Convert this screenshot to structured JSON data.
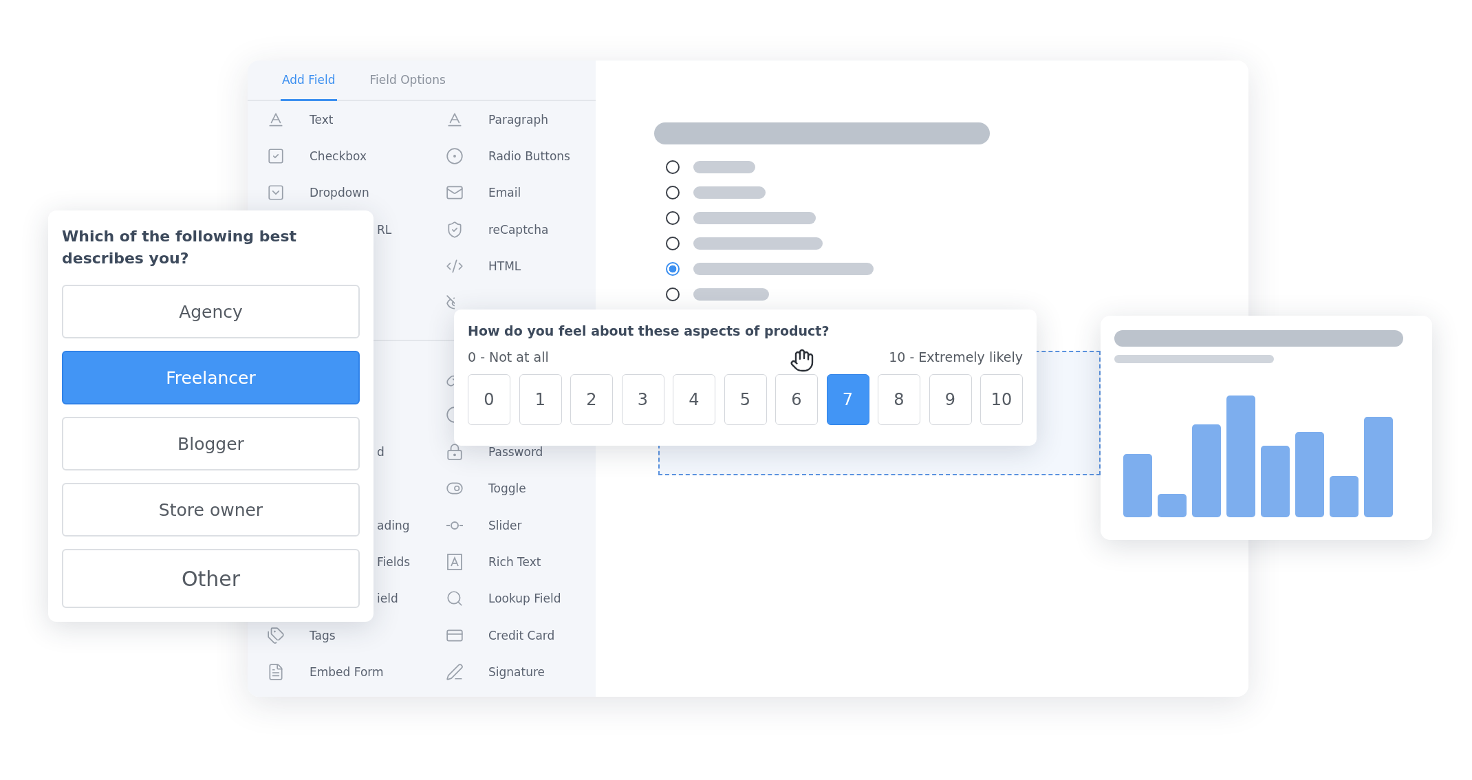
{
  "sidebar": {
    "tabs": [
      {
        "label": "Add Field",
        "selected": true
      },
      {
        "label": "Field Options",
        "selected": false
      }
    ],
    "field_groups": [
      [
        {
          "left": "Text",
          "right": "Paragraph"
        },
        {
          "left": "Checkbox",
          "right": "Radio Buttons"
        },
        {
          "left": "Dropdown",
          "right": "Email"
        },
        {
          "left": "RL",
          "right": "reCaptcha"
        },
        {
          "right": "HTML"
        },
        {
          "kind": "covered"
        }
      ],
      [
        {
          "kind": "covered"
        },
        {
          "kind": "covered"
        },
        {
          "left": "d",
          "right": "Password"
        },
        {
          "right": "Toggle"
        },
        {
          "left": "ading",
          "right": "Slider"
        },
        {
          "left": "Fields",
          "right": "Rich Text"
        },
        {
          "left": "ield",
          "right": "Lookup Field"
        },
        {
          "left": "Tags",
          "right": "Credit Card"
        },
        {
          "left": "Embed Form",
          "right": "Signature"
        }
      ]
    ]
  },
  "canvas": {
    "radio_options": [
      {
        "selected": false
      },
      {
        "selected": false
      },
      {
        "selected": false
      },
      {
        "selected": false
      },
      {
        "selected": true
      },
      {
        "selected": false
      }
    ]
  },
  "choice_card": {
    "question": "Which of the following best describes you?",
    "options": [
      {
        "label": "Agency",
        "selected": false
      },
      {
        "label": "Freelancer",
        "selected": true
      },
      {
        "label": "Blogger",
        "selected": false
      },
      {
        "label": "Store owner",
        "selected": false
      },
      {
        "label": "Other",
        "selected": false
      }
    ]
  },
  "rating_card": {
    "question": "How do you feel about these aspects of product?",
    "low_label": "0 - Not at all",
    "high_label": "10 - Extremely likely",
    "options": [
      {
        "label": "0",
        "selected": false
      },
      {
        "label": "1",
        "selected": false
      },
      {
        "label": "2",
        "selected": false
      },
      {
        "label": "3",
        "selected": false
      },
      {
        "label": "4",
        "selected": false
      },
      {
        "label": "5",
        "selected": false
      },
      {
        "label": "6",
        "selected": false
      },
      {
        "label": "7",
        "selected": true
      },
      {
        "label": "8",
        "selected": false
      },
      {
        "label": "9",
        "selected": false
      },
      {
        "label": "10",
        "selected": false
      }
    ]
  }
}
